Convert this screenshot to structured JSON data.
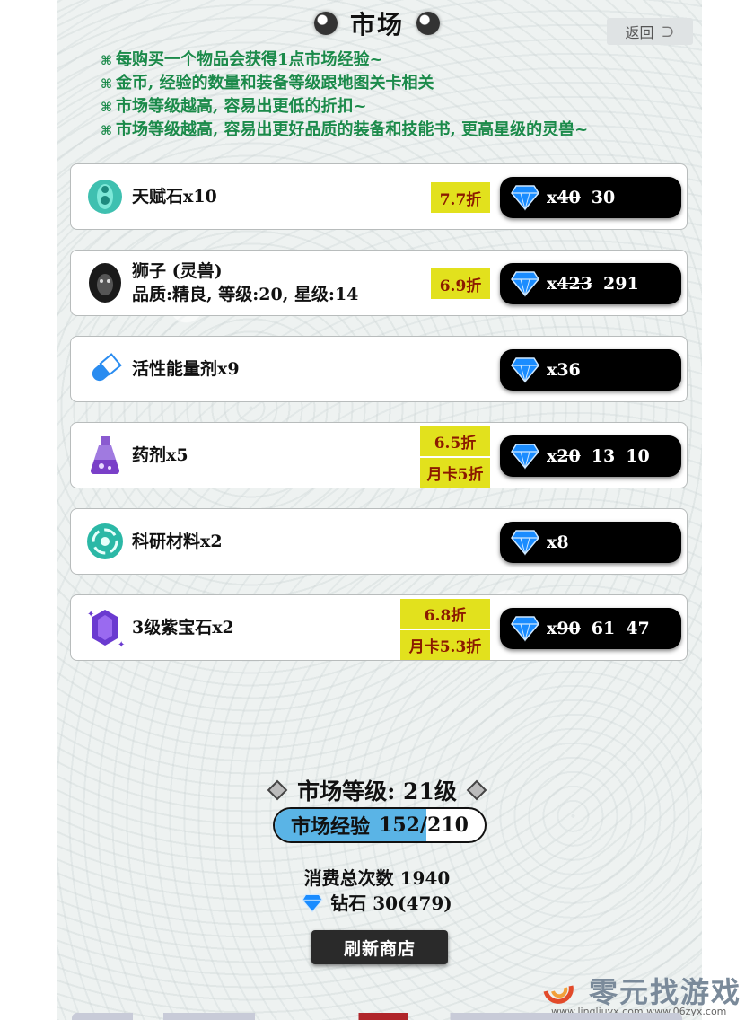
{
  "header": {
    "title": "市场",
    "back_label": "返回"
  },
  "notes": [
    "每购买一个物品会获得1点市场经验~",
    "金币, 经验的数量和装备等级跟地图关卡相关",
    "市场等级越高, 容易出更低的折扣~",
    "市场等级越高, 容易出更好品质的装备和技能书, 更高星级的灵兽~"
  ],
  "note_bullet": "⌘",
  "items": [
    {
      "name": "天赋石x10",
      "sub": "",
      "icon": "talent-stone-icon",
      "discount": "7.7折",
      "card_discount": "",
      "prefix": "x",
      "old_price": "40",
      "prices": [
        "30"
      ]
    },
    {
      "name": "狮子 (灵兽)",
      "sub": "品质:精良, 等级:20, 星级:14",
      "icon": "lion-icon",
      "discount": "6.9折",
      "card_discount": "",
      "prefix": "x",
      "old_price": "423",
      "prices": [
        "291"
      ]
    },
    {
      "name": "活性能量剂x9",
      "sub": "",
      "icon": "pill-icon",
      "discount": "",
      "card_discount": "",
      "prefix": "x",
      "old_price": "",
      "prices": [
        "36"
      ]
    },
    {
      "name": "药剂x5",
      "sub": "",
      "icon": "potion-icon",
      "discount": "6.5折",
      "card_discount": "月卡5折",
      "prefix": "x",
      "old_price": "20",
      "prices": [
        "13",
        "10"
      ]
    },
    {
      "name": "科研材料x2",
      "sub": "",
      "icon": "research-material-icon",
      "discount": "",
      "card_discount": "",
      "prefix": "x",
      "old_price": "",
      "prices": [
        "8"
      ]
    },
    {
      "name": "3级紫宝石x2",
      "sub": "",
      "icon": "purple-gem-icon",
      "discount": "6.8折",
      "card_discount": "月卡5.3折",
      "prefix": "x",
      "old_price": "90",
      "prices": [
        "61",
        "47"
      ]
    }
  ],
  "market": {
    "level_label": "市场等级: 21级",
    "exp_label": "市场经验",
    "exp_current": "152",
    "exp_total": "210",
    "exp_fraction": 0.724,
    "spend_count_label": "消费总次数  1940",
    "diamond_label": "钻石  30(479)"
  },
  "refresh_label": "刷新商店",
  "watermark": {
    "name": "零元找游戏",
    "url": "www.lingliuyx.com   www.06zyx.com"
  },
  "colors": {
    "note_green": "#1b8a4a",
    "discount_yellow": "#e2e11d",
    "discount_text": "#8b1a00",
    "diamond_blue": "#1a8cff",
    "exp_blue": "#5ab4e6"
  }
}
